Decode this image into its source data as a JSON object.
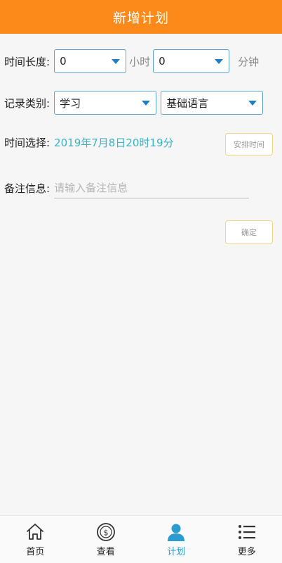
{
  "header": {
    "title": "新增计划"
  },
  "duration": {
    "label": "时间长度:",
    "hours_value": "0",
    "hours_unit": "小时",
    "minutes_value": "0",
    "minutes_unit": "分钟"
  },
  "category": {
    "label": "记录类别:",
    "primary_value": "学习",
    "secondary_value": "基础语言"
  },
  "time_select": {
    "label": "时间选择:",
    "value": "2019年7月8日20时19分",
    "button_label": "安排时间"
  },
  "remark": {
    "label": "备注信息:",
    "placeholder": "请输入备注信息",
    "value": ""
  },
  "confirm_label": "确定",
  "tabbar": {
    "items": [
      {
        "label": "首页",
        "icon": "home-icon",
        "active": false
      },
      {
        "label": "查看",
        "icon": "dollar-coin-icon",
        "active": false
      },
      {
        "label": "计划",
        "icon": "user-icon",
        "active": true
      },
      {
        "label": "更多",
        "icon": "list-icon",
        "active": false
      }
    ]
  },
  "colors": {
    "header": "#fb8a1b",
    "accent": "#2a9cd0",
    "time_text": "#3bb3c3",
    "button_border": "#f1d77e"
  }
}
